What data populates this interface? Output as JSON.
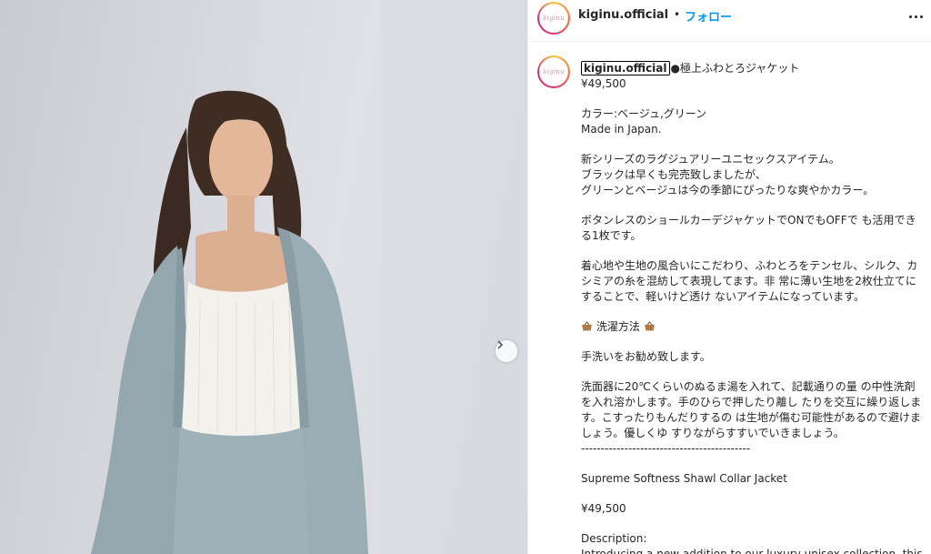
{
  "post": {
    "username": "kiginu.official",
    "separator": "•",
    "follow_label": "フォロー",
    "avatar_logo_text": "kiginu",
    "more_icon": "more-horizontal-icon",
    "next_icon": "chevron-right-icon"
  },
  "caption": {
    "username": "kiginu.official",
    "title": "●極上ふわとろジャケット",
    "price_jp": "¥49,500",
    "color": "カラー:ベージュ,グリーン",
    "made_in": "Made in Japan.",
    "para1": [
      "新シリーズのラグジュアリーユニセックスアイテム。",
      "ブラックは早くも完売致しましたが、",
      "グリーンとベージュは今の季節にぴったりな爽やかカラー。"
    ],
    "para2": "ボタンレスのショールカーデジャケットでONでもOFFで も活用できる1枚です。",
    "para3": "着心地や生地の風合いにこだわり、ふわとろをテンセル、シルク、カシミアの糸を混紡して表現してます。非 常に薄い生地を2枚仕立てにすることで、軽いけど透け ないアイテムになっています。",
    "wash_title": "洗濯方法",
    "wash_line": "手洗いをお勧め致します。",
    "wash_detail": "洗面器に20℃くらいのぬるま湯を入れて、記載通りの量 の中性洗剤を入れ溶かします。手のひらで押したり離し たりを交互に繰り返します。こすったりもんだりするの は生地が傷む可能性があるので避けましょう。優しくゆ すりながらすすいでいきましょう。",
    "divider": "-------------------------------------------",
    "en_title": "Supreme Softness Shawl Collar Jacket",
    "price_en": "¥49,500",
    "desc_label": "Description:",
    "desc_text": "Introducing a new addition to our luxury unisex collection, this"
  },
  "colors": {
    "follow_blue": "#0095f6",
    "text": "#262626",
    "jacket": "#9aacb4"
  }
}
